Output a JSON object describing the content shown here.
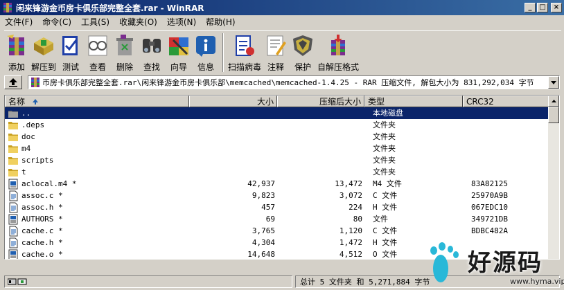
{
  "window": {
    "title": "闲来锋游金币房卡俱乐部完整全套.rar - WinRAR"
  },
  "title_buttons": {
    "minimize": "_",
    "maximize": "□",
    "close": "×"
  },
  "menu": [
    "文件(F)",
    "命令(C)",
    "工具(S)",
    "收藏夹(O)",
    "选项(N)",
    "帮助(H)"
  ],
  "toolbar": [
    {
      "label": "添加",
      "icon": "add-icon"
    },
    {
      "label": "解压到",
      "icon": "extract-to-icon"
    },
    {
      "label": "测试",
      "icon": "test-icon"
    },
    {
      "label": "查看",
      "icon": "view-icon"
    },
    {
      "label": "删除",
      "icon": "delete-icon"
    },
    {
      "label": "查找",
      "icon": "find-icon"
    },
    {
      "label": "向导",
      "icon": "wizard-icon"
    },
    {
      "label": "信息",
      "icon": "info-icon"
    },
    {
      "label": "扫描病毒",
      "icon": "virus-scan-icon"
    },
    {
      "label": "注释",
      "icon": "comment-icon"
    },
    {
      "label": "保护",
      "icon": "protect-icon"
    },
    {
      "label": "自解压格式",
      "icon": "sfx-icon"
    }
  ],
  "address": {
    "path": "币房卡俱乐部完整全套.rar\\闲来锋游金币房卡俱乐部\\memcached\\memcached-1.4.25 - RAR 压缩文件, 解包大小为 831,292,034 字节"
  },
  "columns": {
    "name": "名称",
    "size": "大小",
    "packed": "压缩后大小",
    "type": "类型",
    "crc": "CRC32"
  },
  "files": [
    {
      "name": "..",
      "size": "",
      "packed": "",
      "type": "本地磁盘",
      "crc": "",
      "icon": "folder-up-icon",
      "selected": true
    },
    {
      "name": ".deps",
      "size": "",
      "packed": "",
      "type": "文件夹",
      "crc": "",
      "icon": "folder-icon"
    },
    {
      "name": "doc",
      "size": "",
      "packed": "",
      "type": "文件夹",
      "crc": "",
      "icon": "folder-icon"
    },
    {
      "name": "m4",
      "size": "",
      "packed": "",
      "type": "文件夹",
      "crc": "",
      "icon": "folder-icon"
    },
    {
      "name": "scripts",
      "size": "",
      "packed": "",
      "type": "文件夹",
      "crc": "",
      "icon": "folder-icon"
    },
    {
      "name": "t",
      "size": "",
      "packed": "",
      "type": "文件夹",
      "crc": "",
      "icon": "folder-icon"
    },
    {
      "name": "aclocal.m4 *",
      "size": "42,937",
      "packed": "13,472",
      "type": "M4 文件",
      "crc": "83A82125",
      "icon": "file-m4-icon"
    },
    {
      "name": "assoc.c *",
      "size": "9,823",
      "packed": "3,072",
      "type": "C 文件",
      "crc": "25970A9B",
      "icon": "file-text-icon"
    },
    {
      "name": "assoc.h *",
      "size": "457",
      "packed": "224",
      "type": "H 文件",
      "crc": "067EDC10",
      "icon": "file-text-icon"
    },
    {
      "name": "AUTHORS *",
      "size": "69",
      "packed": "80",
      "type": "文件",
      "crc": "349721DB",
      "icon": "file-generic-icon"
    },
    {
      "name": "cache.c *",
      "size": "3,765",
      "packed": "1,120",
      "type": "C 文件",
      "crc": "BDBC482A",
      "icon": "file-text-icon"
    },
    {
      "name": "cache.h *",
      "size": "4,304",
      "packed": "1,472",
      "type": "H 文件",
      "crc": "",
      "icon": "file-text-icon"
    },
    {
      "name": "cache.o *",
      "size": "14,648",
      "packed": "4,512",
      "type": "O 文件",
      "crc": "",
      "icon": "file-generic-icon"
    }
  ],
  "status": {
    "summary": "总计 5 文件夹 和 5,271,884 字节"
  },
  "watermark": {
    "text": "好源码",
    "url": "www.hyma.vip"
  }
}
